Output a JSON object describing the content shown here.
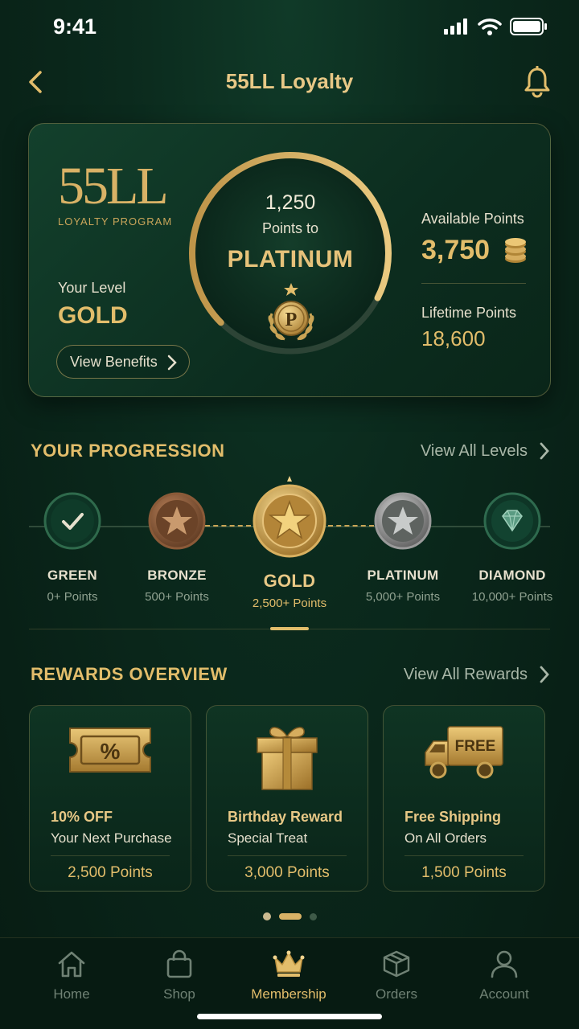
{
  "status": {
    "time": "9:41"
  },
  "header": {
    "title": "55LL Loyalty"
  },
  "card": {
    "logo": "55LL",
    "logo_sub": "LOYALTY PROGRAM",
    "level_label": "Your Level",
    "level_value": "GOLD",
    "benefits_label": "View Benefits",
    "ring_points": "1,250",
    "ring_sub": "Points to",
    "ring_tier": "PLATINUM",
    "ring_progress": 0.7,
    "badge_letter": "P",
    "available_label": "Available Points",
    "available_value": "3,750",
    "lifetime_label": "Lifetime Points",
    "lifetime_value": "18,600"
  },
  "progression": {
    "title": "YOUR PROGRESSION",
    "link": "View All Levels",
    "tiers": [
      {
        "name": "GREEN",
        "points": "0+ Points"
      },
      {
        "name": "BRONZE",
        "points": "500+ Points"
      },
      {
        "name": "GOLD",
        "points": "2,500+ Points"
      },
      {
        "name": "PLATINUM",
        "points": "5,000+ Points"
      },
      {
        "name": "DIAMOND",
        "points": "10,000+ Points"
      }
    ]
  },
  "rewards": {
    "title": "REWARDS OVERVIEW",
    "link": "View All Rewards",
    "items": [
      {
        "title": "10% OFF",
        "subtitle": "Your Next Purchase",
        "points": "2,500 Points",
        "icon": "ticket-icon",
        "art_text": "%"
      },
      {
        "title": "Birthday Reward",
        "subtitle": "Special Treat",
        "points": "3,000 Points",
        "icon": "gift-icon"
      },
      {
        "title": "Free Shipping",
        "subtitle": "On All Orders",
        "points": "1,500 Points",
        "icon": "truck-icon",
        "art_text": "FREE"
      }
    ]
  },
  "tabs": [
    {
      "label": "Home",
      "icon": "home-icon"
    },
    {
      "label": "Shop",
      "icon": "bag-icon"
    },
    {
      "label": "Membership",
      "icon": "crown-icon"
    },
    {
      "label": "Orders",
      "icon": "box-icon"
    },
    {
      "label": "Account",
      "icon": "person-icon"
    }
  ],
  "colors": {
    "accent": "#e2bd6b",
    "background": "#0b2a1d"
  }
}
